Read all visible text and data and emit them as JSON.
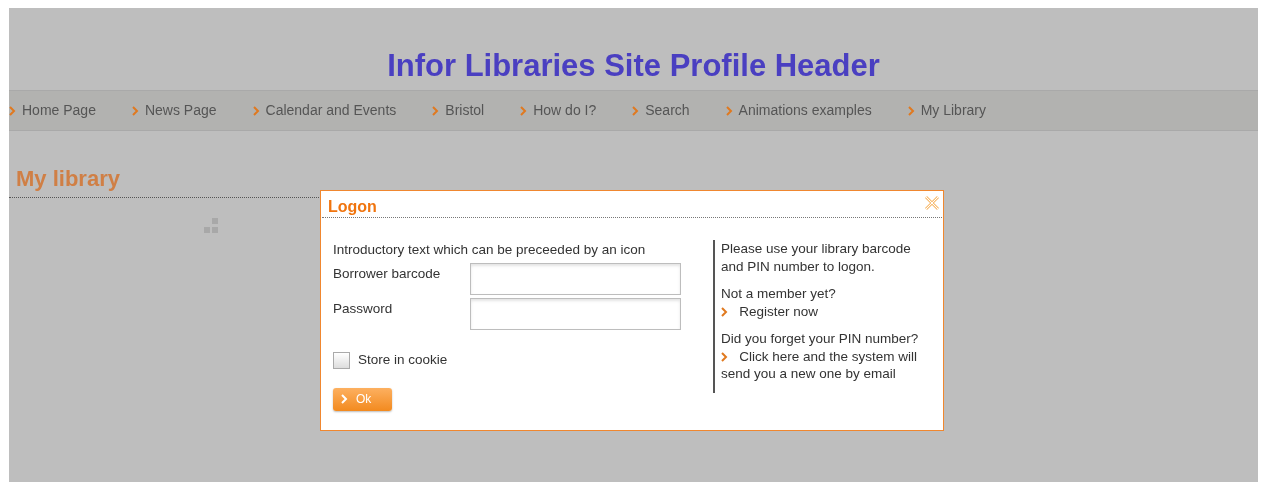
{
  "header": {
    "title": "Infor Libraries Site Profile Header"
  },
  "nav": [
    {
      "label": "Home Page"
    },
    {
      "label": "News Page"
    },
    {
      "label": "Calendar and Events"
    },
    {
      "label": "Bristol"
    },
    {
      "label": "How do I?"
    },
    {
      "label": "Search"
    },
    {
      "label": "Animations examples"
    },
    {
      "label": "My Library"
    }
  ],
  "page_title": "My library",
  "dialog": {
    "title": "Logon",
    "intro": "Introductory text which can be preceeded by an icon",
    "fields": [
      {
        "label": "Borrower barcode"
      },
      {
        "label": "Password"
      }
    ],
    "remember": {
      "label": "Store in cookie",
      "checked": false
    },
    "submit": "Ok",
    "help": [
      {
        "text": "Please use your library barcode and PIN number to logon."
      },
      {
        "text": "Not a member yet?",
        "link": "Register now"
      },
      {
        "text": "Did you forget your PIN number?",
        "link": "Click here and the system will send you a new one by email"
      }
    ]
  }
}
